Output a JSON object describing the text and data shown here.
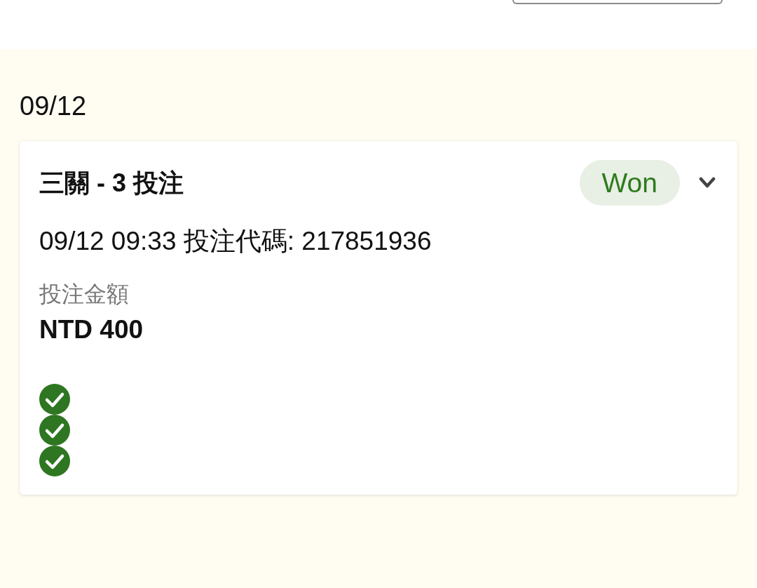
{
  "date": "09/12",
  "bet": {
    "title": "三關 - 3 投注",
    "status": {
      "label": "Won",
      "kind": "won"
    },
    "expanded": false,
    "placed": "09/12 09:33 投注代碼: 217851936",
    "stake_label": "投注金額",
    "stake": "NTD 400",
    "legs": [
      {
        "kind": "won"
      },
      {
        "kind": "won"
      },
      {
        "kind": "won"
      }
    ]
  }
}
